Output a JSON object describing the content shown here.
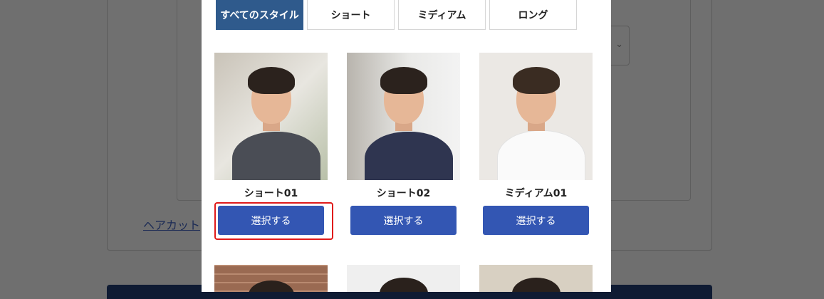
{
  "background": {
    "link_text": "ヘアカット"
  },
  "modal": {
    "tabs": [
      {
        "label": "すべてのスタイル",
        "active": true
      },
      {
        "label": "ショート",
        "active": false
      },
      {
        "label": "ミディアム",
        "active": false
      },
      {
        "label": "ロング",
        "active": false
      }
    ],
    "styles": [
      {
        "name": "ショート01",
        "button": "選択する",
        "highlighted": true
      },
      {
        "name": "ショート02",
        "button": "選択する",
        "highlighted": false
      },
      {
        "name": "ミディアム01",
        "button": "選択する",
        "highlighted": false
      }
    ],
    "partial_row_count": 3
  },
  "colors": {
    "accent_tab": "#2f5a8c",
    "button": "#3356b3",
    "highlight": "#e01a1a"
  }
}
